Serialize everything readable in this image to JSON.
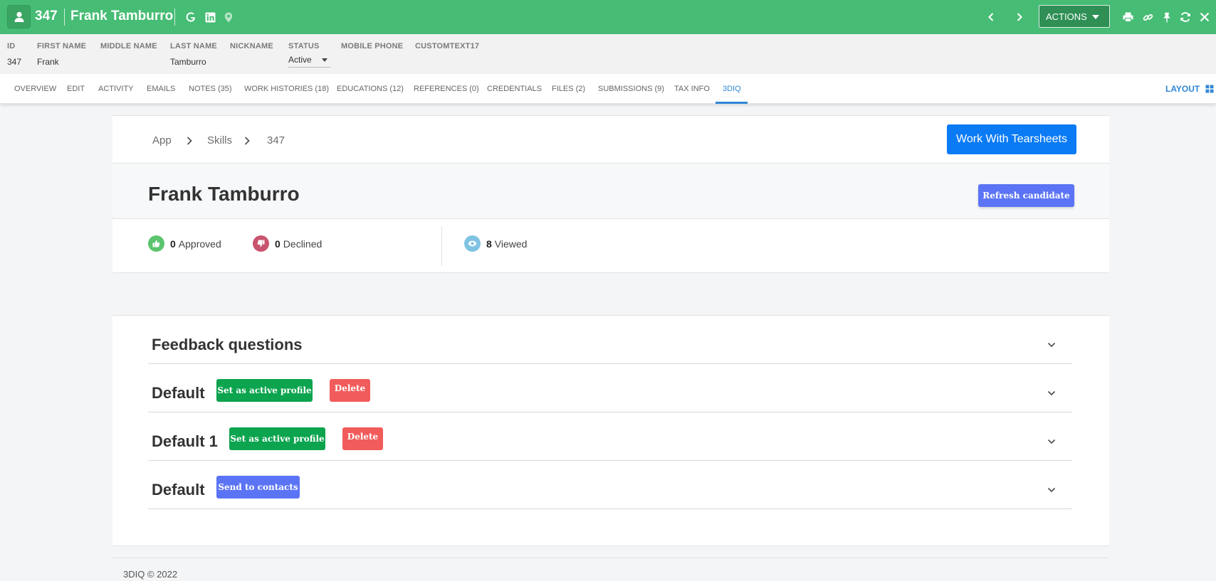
{
  "header": {
    "record_id": "347",
    "record_name": "Frank Tamburro",
    "actions_label": "ACTIONS",
    "colors": {
      "bar": "#46bc74",
      "actions_bg": "#2f8f55"
    }
  },
  "info": {
    "fields": [
      {
        "label": "ID",
        "value": "347"
      },
      {
        "label": "FIRST NAME",
        "value": "Frank"
      },
      {
        "label": "MIDDLE NAME",
        "value": ""
      },
      {
        "label": "LAST NAME",
        "value": "Tamburro"
      },
      {
        "label": "NICKNAME",
        "value": ""
      },
      {
        "label": "STATUS",
        "value": "Active"
      },
      {
        "label": "MOBILE PHONE",
        "value": ""
      },
      {
        "label": "CUSTOMTEXT17",
        "value": ""
      }
    ]
  },
  "tabs": {
    "items": [
      "OVERVIEW",
      "EDIT",
      "ACTIVITY",
      "EMAILS",
      "NOTES (35)",
      "WORK HISTORIES (18)",
      "EDUCATIONS (12)",
      "REFERENCES (0)",
      "CREDENTIALS",
      "FILES (2)",
      "SUBMISSIONS (9)",
      "TAX INFO",
      "3DIQ"
    ],
    "active": "3DIQ",
    "layout_label": "LAYOUT"
  },
  "breadcrumb": {
    "items": [
      "App",
      "Skills",
      "347"
    ]
  },
  "buttons": {
    "work_with_tearsheets": "Work With Tearsheets",
    "refresh_candidate": "Refresh candidate",
    "set_active_profile": "Set as active profile",
    "delete": "Delete",
    "send_to_contacts": "Send to contacts"
  },
  "profile": {
    "name": "Frank Tamburro"
  },
  "stats": {
    "approved": {
      "count": "0",
      "label": "Approved"
    },
    "declined": {
      "count": "0",
      "label": "Declined"
    },
    "viewed": {
      "count": "8",
      "label": "Viewed"
    }
  },
  "accordion": {
    "sections": [
      {
        "title": "Feedback questions"
      },
      {
        "title": "Default"
      },
      {
        "title": "Default 1"
      },
      {
        "title": "Default"
      }
    ]
  },
  "footer": {
    "text": "3DIQ © 2022"
  },
  "colors": {
    "accent_blue": "#2f86d6",
    "primary": "#0a7bf5",
    "indigo": "#5b74f5",
    "green": "#0ca44e",
    "red": "#f25b5b"
  },
  "icons": {
    "header": [
      "candidate-avatar-icon",
      "google-icon",
      "linkedin-icon",
      "location-pin-icon",
      "chevron-left-icon",
      "chevron-right-icon",
      "print-icon",
      "link-icon",
      "pin-icon",
      "refresh-icon",
      "close-icon"
    ],
    "stats": [
      "thumbs-up-icon",
      "thumbs-down-icon",
      "eye-icon"
    ]
  }
}
